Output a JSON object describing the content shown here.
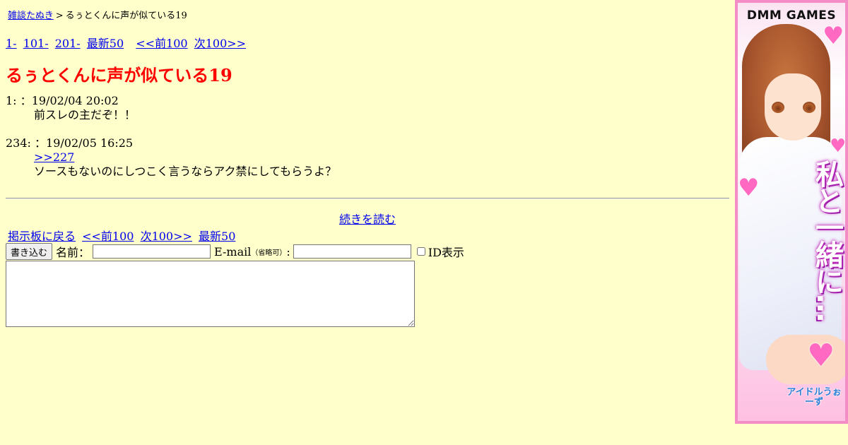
{
  "breadcrumb": {
    "board_link": "雑談たぬき",
    "separator": ">",
    "current": "るぅとくんに声が似ている19"
  },
  "pager_top": [
    {
      "label": "1-"
    },
    {
      "label": "101-"
    },
    {
      "label": "201-"
    },
    {
      "label": "最新50"
    },
    {
      "label": "<<前100"
    },
    {
      "label": "次100>>"
    }
  ],
  "thread_title": "るぅとくんに声が似ている19",
  "posts": [
    {
      "number": "1:",
      "name_sep": "：",
      "datetime": "19/02/04 20:02",
      "lines": [
        "前スレの主だぞ！！"
      ]
    },
    {
      "number": "234:",
      "name_sep": "：",
      "datetime": "19/02/05 16:25",
      "anchor": ">>227",
      "lines": [
        "ソースもないのにしつこく言うならアク禁にしてもらうよ？"
      ]
    }
  ],
  "read_more": "続きを読む",
  "pager_bottom": [
    {
      "label": "掲示板に戻る"
    },
    {
      "label": "<<前100"
    },
    {
      "label": "次100>>"
    },
    {
      "label": "最新50"
    }
  ],
  "form": {
    "submit_label": "書き込む",
    "name_label": "名前：",
    "name_value": "",
    "email_label": "E-mail",
    "email_note": "（省略可）",
    "email_colon": ":",
    "email_value": "",
    "id_display_label": "ID表示",
    "id_display_checked": false,
    "message_value": ""
  },
  "ad": {
    "logo": "DMM GAMES",
    "catchphrase": "私と一緒に…",
    "game_title": "アイドルうぉーず",
    "colors": {
      "border": "#f48cc6",
      "heart": "#ff69c2",
      "copy_glow": "#c22abb"
    }
  },
  "colors": {
    "background": "#ffffcc",
    "title": "#ff0000",
    "link": "#0000ee"
  }
}
